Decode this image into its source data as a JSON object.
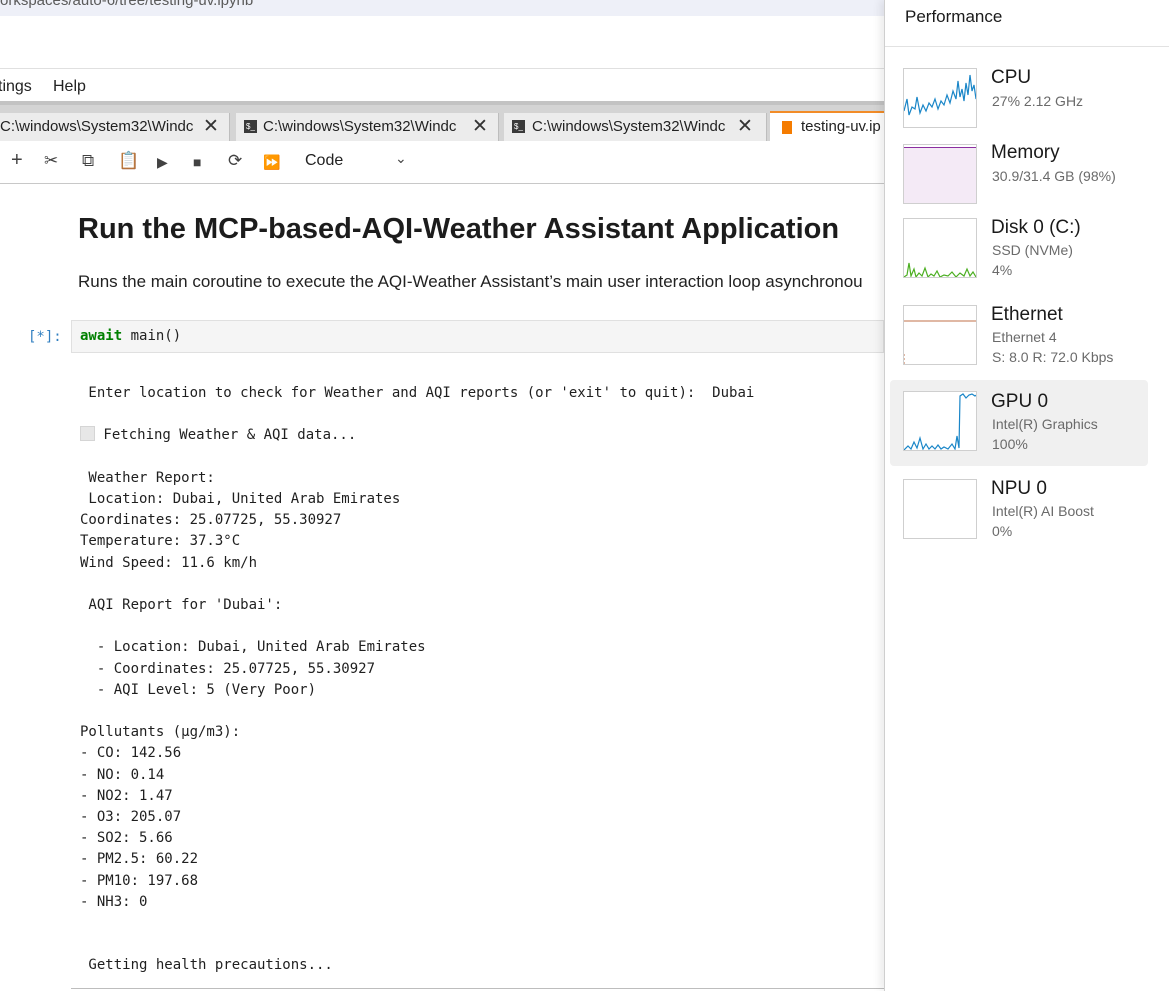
{
  "browser": {
    "url": "orkspaces/auto-6/tree/testing-uv.ipynb"
  },
  "menu": {
    "items": [
      "tings",
      "Help"
    ]
  },
  "tabs": [
    {
      "label": "C:\\windows\\System32\\Windc",
      "icon": "terminal-icon"
    },
    {
      "label": "C:\\windows\\System32\\Windc",
      "icon": "terminal-icon"
    },
    {
      "label": "C:\\windows\\System32\\Windc",
      "icon": "terminal-icon"
    },
    {
      "label": "testing-uv.ip",
      "icon": "notebook-icon",
      "active": true
    }
  ],
  "toolbar": {
    "icons": [
      "add-cell-icon",
      "cut-icon",
      "copy-icon",
      "paste-icon",
      "run-icon",
      "stop-icon",
      "restart-icon",
      "run-all-icon"
    ],
    "cell_type": "Code"
  },
  "notebook": {
    "title": "Run the MCP-based-AQI-Weather Assistant Application",
    "description": "Runs the main coroutine to execute the AQI-Weather Assistant’s main user interaction loop asynchronou",
    "cell": {
      "prompt": "[*]:",
      "code_keyword": "await",
      "code_rest": " main()"
    },
    "output_lines": [
      " Enter location to check for Weather and AQI reports (or 'exit' to quit):  Dubai",
      "",
      "  Fetching Weather & AQI data...",
      "",
      " Weather Report:",
      " Location: Dubai, United Arab Emirates",
      "Coordinates: 25.07725, 55.30927",
      "Temperature: 37.3°C",
      "Wind Speed: 11.6 km/h",
      "",
      " AQI Report for 'Dubai':",
      "",
      "  - Location: Dubai, United Arab Emirates",
      "  - Coordinates: 25.07725, 55.30927",
      "  - AQI Level: 5 (Very Poor)",
      "",
      "Pollutants (µg/m3):",
      "- CO: 142.56",
      "- NO: 0.14",
      "- NO2: 1.47",
      "- O3: 205.07",
      "- SO2: 5.66",
      "- PM2.5: 60.22",
      "- PM10: 197.68",
      "- NH3: 0",
      "",
      "",
      " Getting health precautions..."
    ]
  },
  "performance": {
    "title": "Performance",
    "items": [
      {
        "name": "CPU",
        "details": [
          "27%  2.12 GHz"
        ],
        "color": "#1a86c8",
        "selected": false
      },
      {
        "name": "Memory",
        "details": [
          "30.9/31.4 GB (98%)"
        ],
        "color": "#8b2fa0",
        "selected": false
      },
      {
        "name": "Disk 0 (C:)",
        "details": [
          "SSD (NVMe)",
          "4%"
        ],
        "color": "#4caf22",
        "selected": false
      },
      {
        "name": "Ethernet",
        "details": [
          "Ethernet 4",
          "S: 8.0  R: 72.0 Kbps"
        ],
        "color": "#c0704a",
        "selected": false
      },
      {
        "name": "GPU 0",
        "details": [
          "Intel(R) Graphics",
          "100%"
        ],
        "color": "#1a86c8",
        "selected": true
      },
      {
        "name": "NPU 0",
        "details": [
          "Intel(R) AI Boost",
          "0%"
        ],
        "color": "#1a86c8",
        "selected": false
      }
    ]
  }
}
